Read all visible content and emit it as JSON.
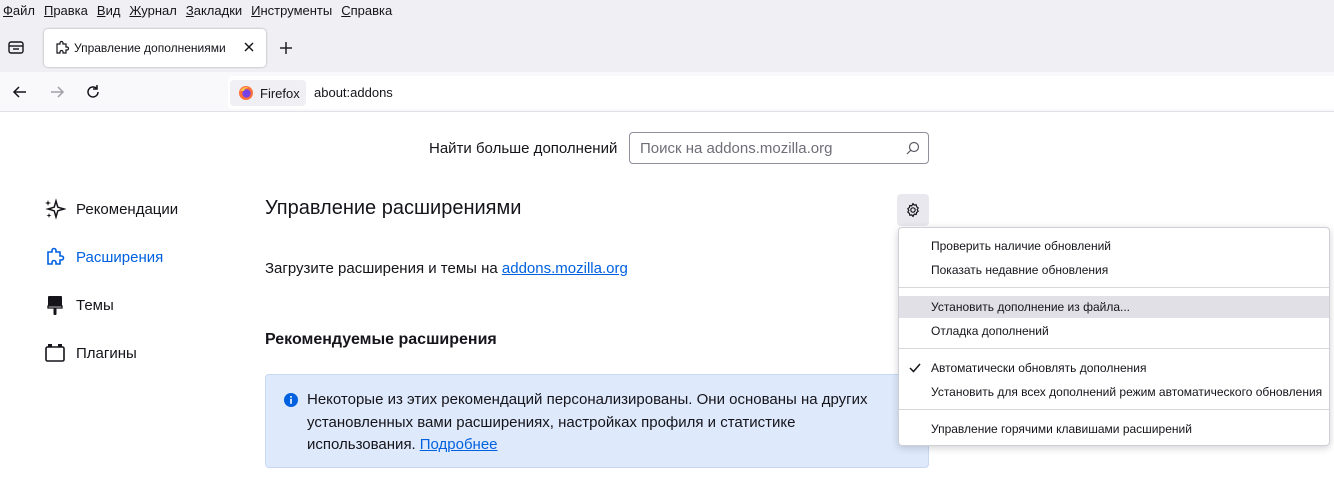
{
  "menubar": {
    "items": [
      {
        "underline": "Ф",
        "rest": "айл"
      },
      {
        "underline": "П",
        "rest": "равка"
      },
      {
        "underline": "В",
        "rest": "ид"
      },
      {
        "underline": "Ж",
        "rest": "урнал"
      },
      {
        "underline": "З",
        "rest": "акладки"
      },
      {
        "underline": "И",
        "rest": "нструменты"
      },
      {
        "underline": "С",
        "rest": "правка"
      }
    ]
  },
  "tab": {
    "title": "Управление дополнениями",
    "icon": "puzzle-icon"
  },
  "navbar": {
    "identity_label": "Firefox",
    "url": "about:addons"
  },
  "search": {
    "label": "Найти больше дополнений",
    "placeholder": "Поиск на addons.mozilla.org"
  },
  "sidebar": {
    "items": [
      {
        "label": "Рекомендации",
        "icon": "sparkle-icon",
        "active": false
      },
      {
        "label": "Расширения",
        "icon": "puzzle-icon",
        "active": true
      },
      {
        "label": "Темы",
        "icon": "brush-icon",
        "active": false
      },
      {
        "label": "Плагины",
        "icon": "plugin-icon",
        "active": false
      }
    ]
  },
  "main": {
    "heading": "Управление расширениями",
    "get_text": "Загрузите расширения и темы на",
    "get_link": "addons.mozilla.org",
    "recommended_heading": "Рекомендуемые расширения",
    "info_text": "Некоторые из этих рекомендаций персонализированы. Они основаны на других установленных вами расширениях, настройках профиля и статистике использования.",
    "info_link": "Подробнее"
  },
  "dropdown": {
    "items": [
      "Проверить наличие обновлений",
      "Показать недавние обновления",
      "Установить дополнение из файла...",
      "Отладка дополнений",
      "Автоматически обновлять дополнения",
      "Установить для всех дополнений режим автоматического обновления",
      "Управление горячими клавишами расширений"
    ]
  },
  "colors": {
    "accent": "#0061e0",
    "chrome_bg": "#f0f0f4",
    "info_bg": "#deeafc"
  }
}
